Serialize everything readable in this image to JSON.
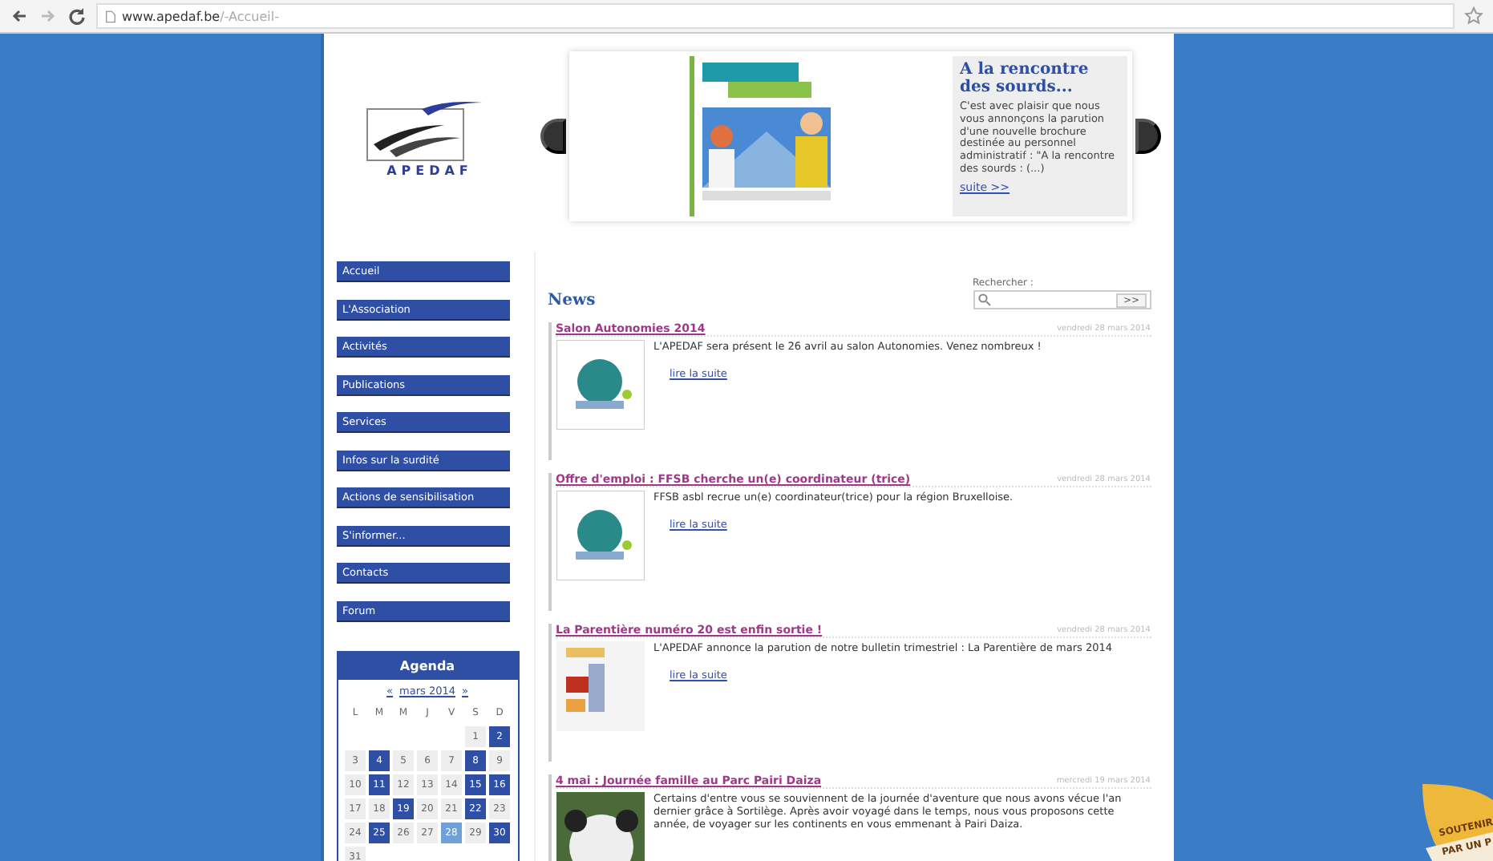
{
  "browser": {
    "url_host": "www.apedaf.be",
    "url_path": "/-Accueil-"
  },
  "header": {
    "logo_text": "APEDAF",
    "slide": {
      "title": "A la rencontre des sourds...",
      "body": "C'est avec plaisir que nous vous annonçons la parution d'une nouvelle brochure destinée au personnel administratif : \"A la rencontre des sourds : (...)",
      "link": "suite >>"
    }
  },
  "menu": [
    {
      "label": "Accueil"
    },
    {
      "label": "L'Association"
    },
    {
      "label": "Activités"
    },
    {
      "label": "Publications"
    },
    {
      "label": "Services"
    },
    {
      "label": "Infos sur la surdité"
    },
    {
      "label": "Actions de sensibilisation"
    },
    {
      "label": "S'informer..."
    },
    {
      "label": "Contacts"
    },
    {
      "label": "Forum"
    }
  ],
  "agenda": {
    "title": "Agenda",
    "prev": "«",
    "month": "mars 2014",
    "next": "»",
    "weekdays": [
      "L",
      "M",
      "M",
      "J",
      "V",
      "S",
      "D"
    ],
    "weeks": [
      [
        {
          "day": "1",
          "kind": "plain"
        },
        {
          "day": "2",
          "kind": "event"
        }
      ],
      [
        {
          "day": "3",
          "kind": "plain"
        },
        {
          "day": "4",
          "kind": "event"
        },
        {
          "day": "5",
          "kind": "plain"
        },
        {
          "day": "6",
          "kind": "plain"
        },
        {
          "day": "7",
          "kind": "plain"
        },
        {
          "day": "8",
          "kind": "event"
        },
        {
          "day": "9",
          "kind": "plain"
        }
      ],
      [
        {
          "day": "10",
          "kind": "plain"
        },
        {
          "day": "11",
          "kind": "event"
        },
        {
          "day": "12",
          "kind": "plain"
        },
        {
          "day": "13",
          "kind": "plain"
        },
        {
          "day": "14",
          "kind": "plain"
        },
        {
          "day": "15",
          "kind": "event"
        },
        {
          "day": "16",
          "kind": "event"
        }
      ],
      [
        {
          "day": "17",
          "kind": "plain"
        },
        {
          "day": "18",
          "kind": "plain"
        },
        {
          "day": "19",
          "kind": "event"
        },
        {
          "day": "20",
          "kind": "plain"
        },
        {
          "day": "21",
          "kind": "plain"
        },
        {
          "day": "22",
          "kind": "event"
        },
        {
          "day": "23",
          "kind": "plain"
        }
      ],
      [
        {
          "day": "24",
          "kind": "plain"
        },
        {
          "day": "25",
          "kind": "event"
        },
        {
          "day": "26",
          "kind": "plain"
        },
        {
          "day": "27",
          "kind": "plain"
        },
        {
          "day": "28",
          "kind": "today"
        },
        {
          "day": "29",
          "kind": "plain"
        },
        {
          "day": "30",
          "kind": "event"
        }
      ],
      [
        {
          "day": "31",
          "kind": "plain"
        }
      ]
    ]
  },
  "news": {
    "heading": "News",
    "search_label": "Rechercher :",
    "search_button": ">>",
    "items": [
      {
        "title": "Salon Autonomies 2014",
        "date": "vendredi 28 mars 2014",
        "text": "L'APEDAF sera présent le 26 avril au salon Autonomies. Venez nombreux !",
        "link": "lire la suite",
        "kind": "picture"
      },
      {
        "title": "Offre d'emploi : FFSB cherche un(e) coordinateur (trice)",
        "date": "vendredi 28 mars 2014",
        "text": "FFSB asbl recrue un(e) coordinateur(trice) pour la région Bruxelloise.",
        "link": "lire la suite",
        "kind": "picture"
      },
      {
        "title": "La Parentière numéro 20 est enfin sortie !",
        "date": "vendredi 28 mars 2014",
        "text": "L'APEDAF annonce la parution de notre bulletin trimestriel : La Parentière de mars 2014",
        "link": "lire la suite",
        "kind": "picture"
      },
      {
        "title": "4 mai : Journée famille au Parc Pairi Daiza",
        "date": "mercredi 19 mars 2014",
        "text": "Certains d'entre vous se souviennent de la journée d'aventure que nous avons vécue l'an dernier grâce à Sortilège. Après avoir voyagé dans le temps, nous vous proposons cette année, de voyager sur les continents en vous emmenant à Pairi Daiza.",
        "kind": "picture"
      }
    ]
  },
  "corner_badge": {
    "lines": [
      "SOUTENIR",
      "PAR UN P"
    ]
  }
}
